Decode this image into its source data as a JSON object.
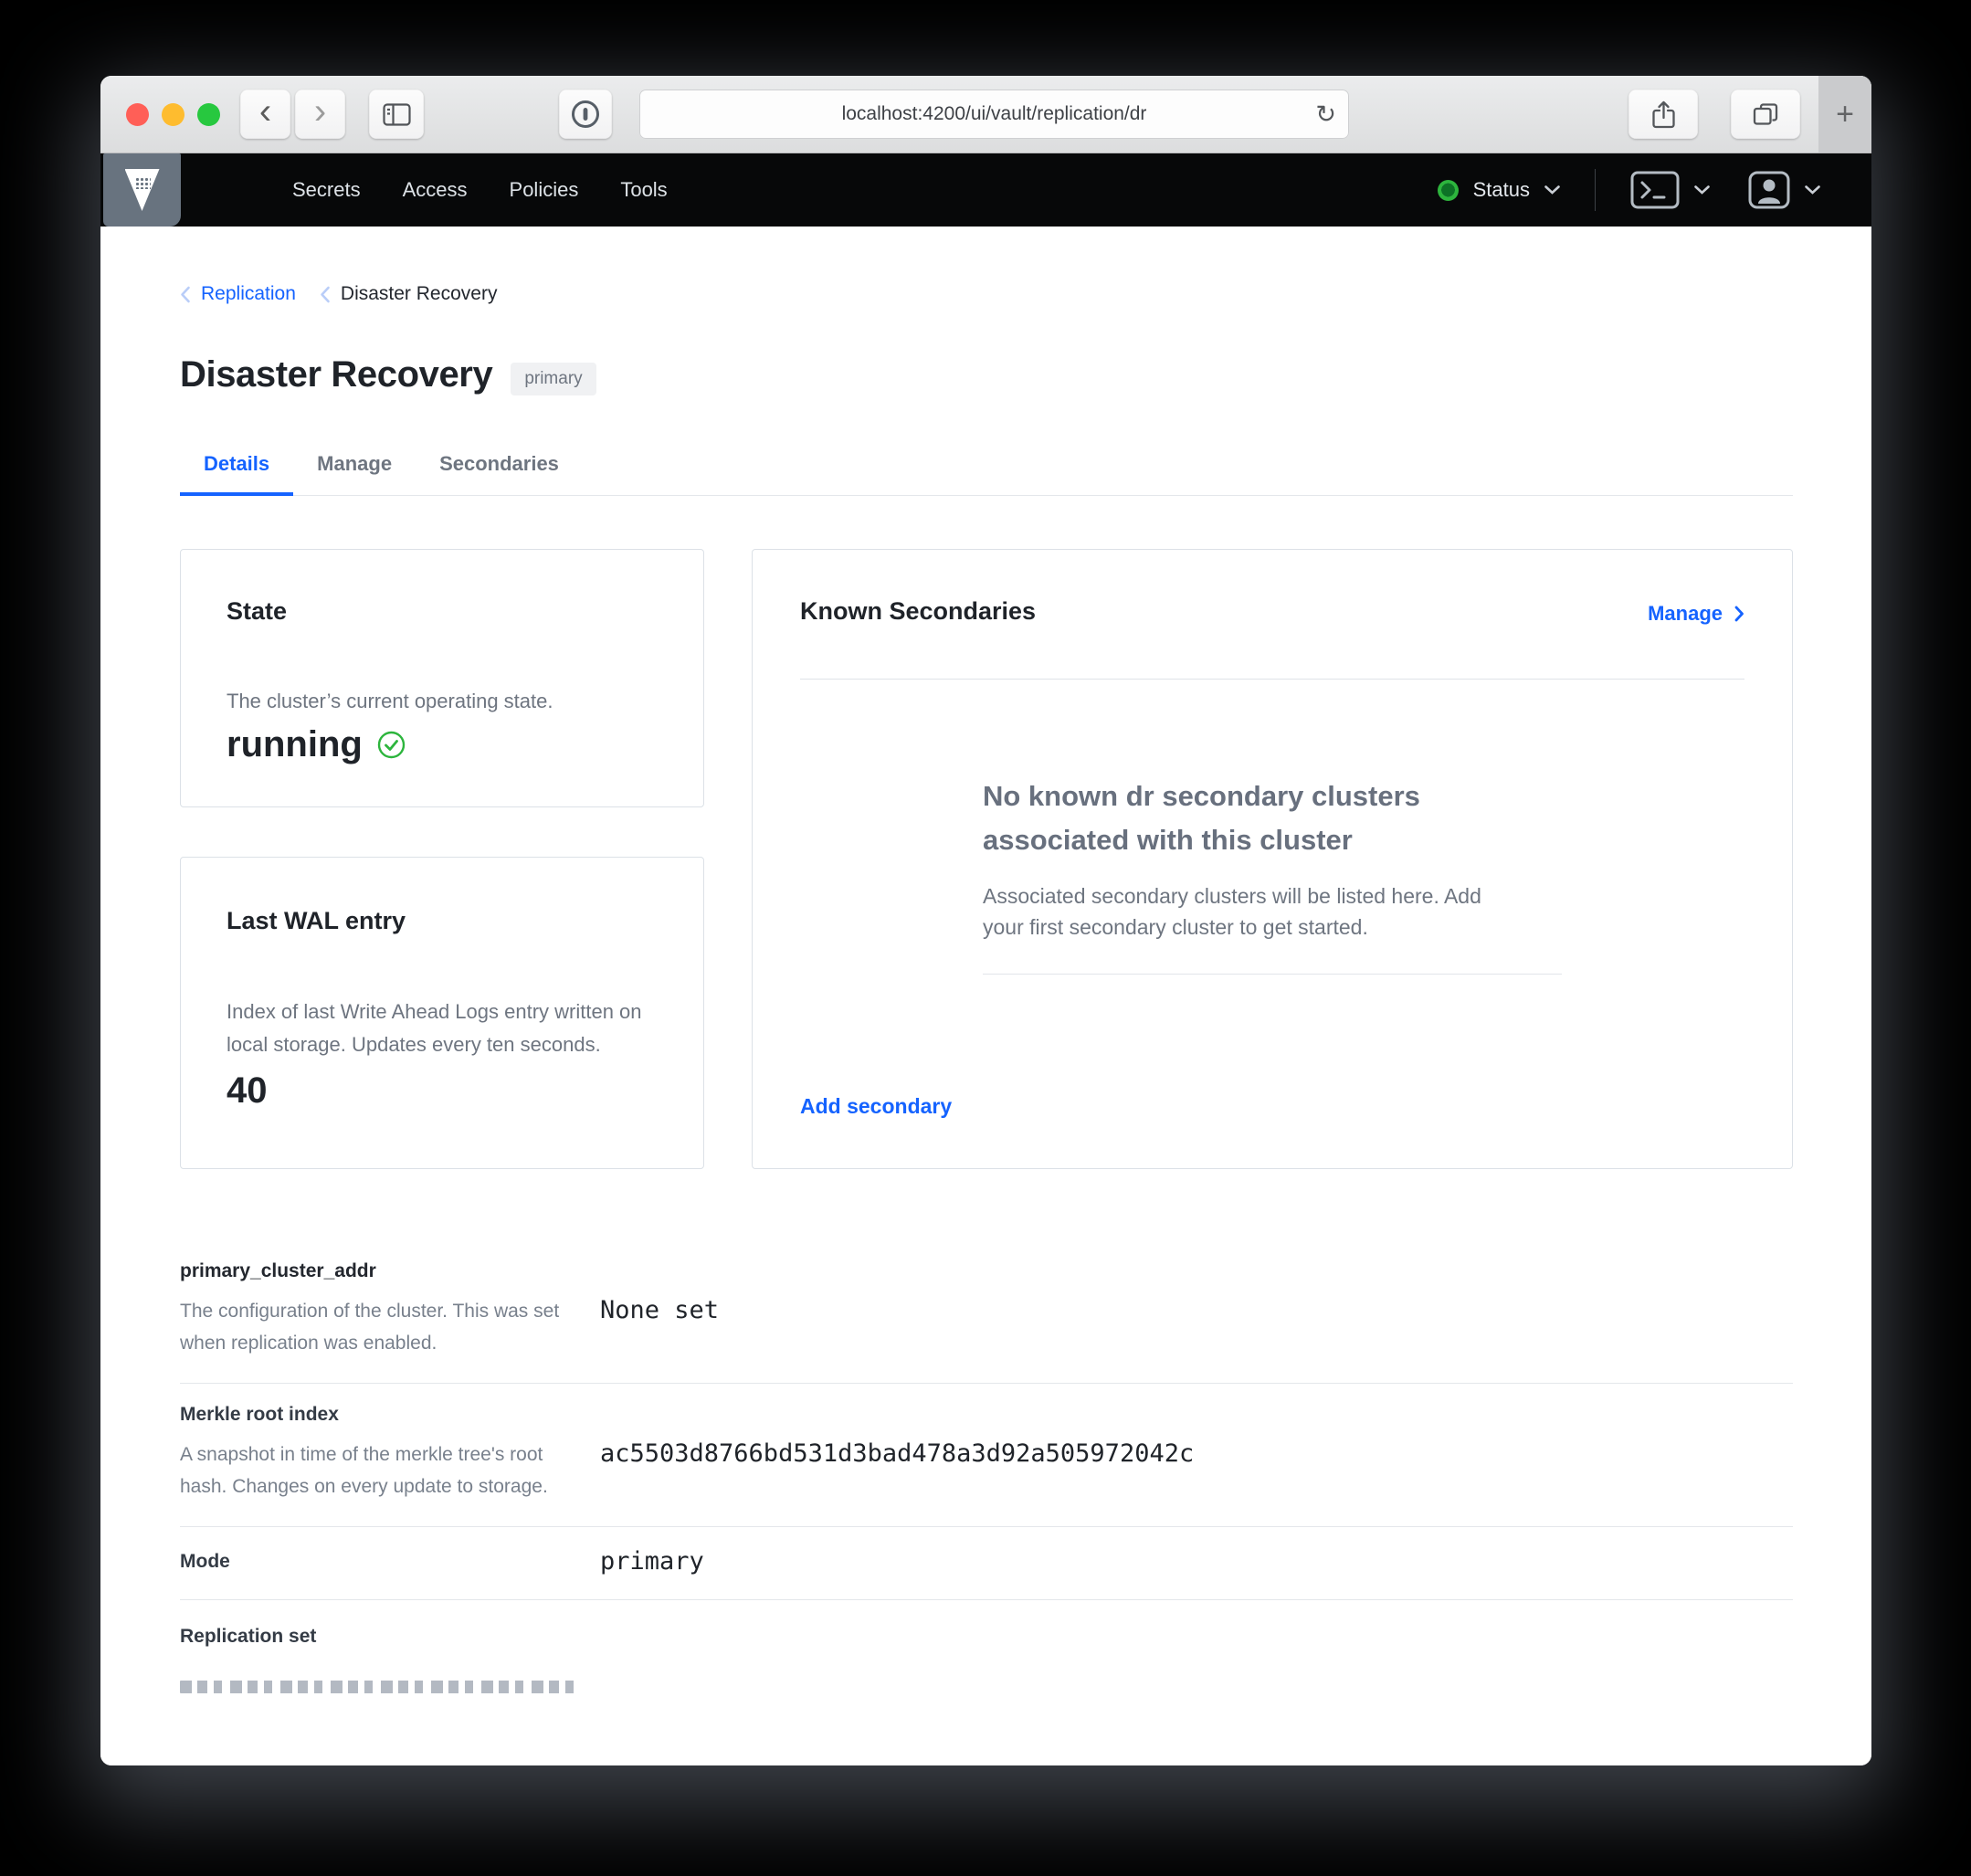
{
  "browser": {
    "url": "localhost:4200/ui/vault/replication/dr",
    "back_glyph": "‹",
    "forward_glyph": "›",
    "reload_glyph": "↻",
    "new_tab_glyph": "+"
  },
  "nav": {
    "links": [
      "Secrets",
      "Access",
      "Policies",
      "Tools"
    ],
    "status_label": "Status"
  },
  "breadcrumb": {
    "items": [
      "Replication",
      "Disaster Recovery"
    ]
  },
  "page": {
    "title": "Disaster Recovery",
    "badge": "primary",
    "tabs": [
      "Details",
      "Manage",
      "Secondaries"
    ],
    "active_tab": "Details"
  },
  "cards": {
    "state": {
      "title": "State",
      "description": "The cluster’s current operating state.",
      "value": "running"
    },
    "last_wal": {
      "title": "Last WAL entry",
      "description": "Index of last Write Ahead Logs entry written on local storage. Updates every ten seconds.",
      "value": "40"
    },
    "known_secondaries": {
      "title": "Known Secondaries",
      "manage_label": "Manage",
      "empty_title": "No known dr secondary clusters associated with this cluster",
      "empty_body": "Associated secondary clusters will be listed here. Add your first secondary cluster to get started.",
      "add_label": "Add secondary"
    }
  },
  "details": {
    "rows": [
      {
        "label": "primary_cluster_addr",
        "description": "The configuration of the cluster. This was set when replication was enabled.",
        "value": "None set"
      },
      {
        "label": "Merkle root index",
        "description": "A snapshot in time of the merkle tree's root hash. Changes on every update to storage.",
        "value": "ac5503d8766bd531d3bad478a3d92a505972042c"
      },
      {
        "label": "Mode",
        "description": "",
        "value": "primary"
      },
      {
        "label": "Replication set",
        "description": "",
        "value": ""
      }
    ]
  },
  "colors": {
    "accent": "#1563ff",
    "success_green": "#2db53d",
    "nav_bg": "#070809"
  }
}
